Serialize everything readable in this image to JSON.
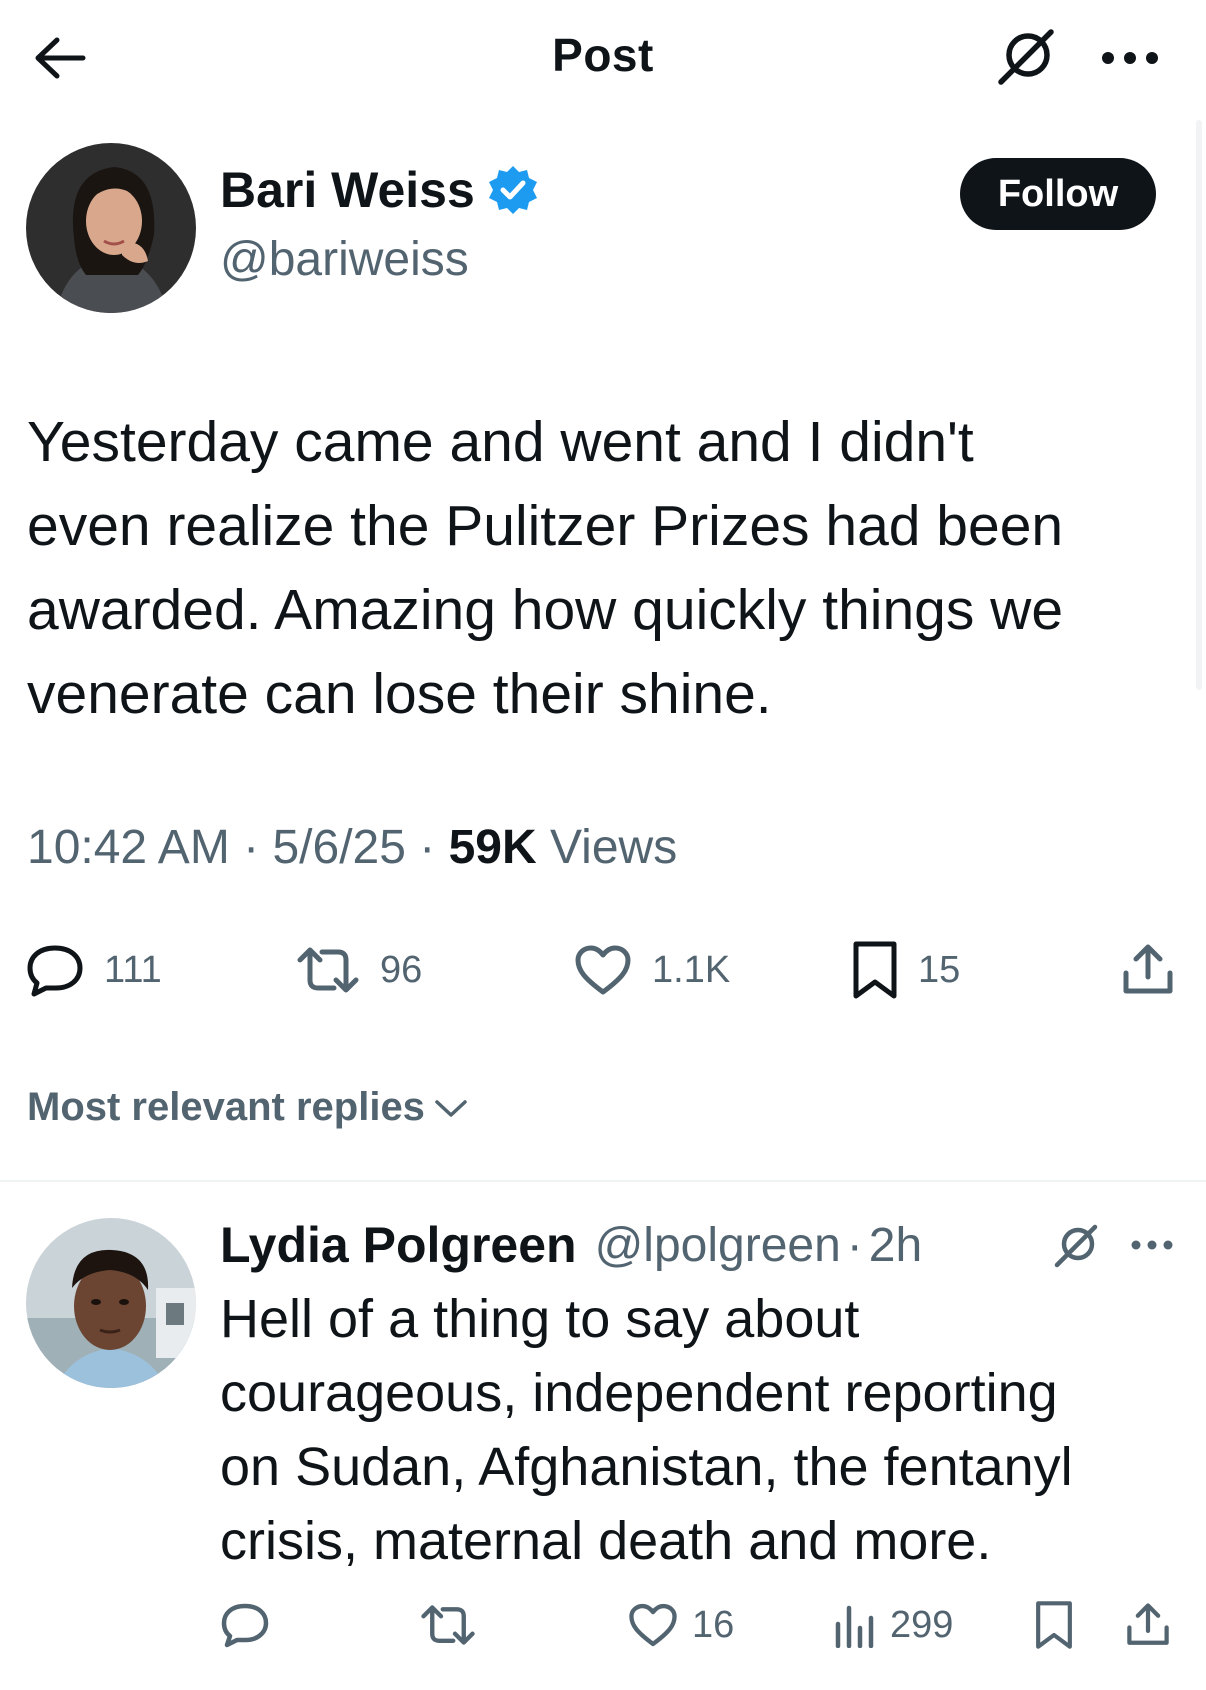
{
  "header": {
    "title": "Post",
    "back_icon": "arrow-left-icon",
    "grok_icon": "grok-icon",
    "more_icon": "more-horizontal-icon"
  },
  "post": {
    "author": {
      "name": "Bari Weiss",
      "handle": "@bariweiss",
      "verified": true,
      "verified_color": "#1d9bf0"
    },
    "follow_label": "Follow",
    "text_lines": [
      "Yesterday came and went and I didn't",
      "even realize the Pulitzer Prizes had been",
      "awarded. Amazing how quickly things we",
      "venerate can lose their shine."
    ],
    "time": "10:42 AM",
    "date": "5/6/25",
    "separator": "·",
    "views_count": "59K",
    "views_label": "Views",
    "stats": {
      "replies": "111",
      "reposts": "96",
      "likes": "1.1K",
      "bookmarks": "15"
    }
  },
  "replies_section": {
    "sort_label": "Most relevant replies"
  },
  "reply": {
    "name": "Lydia Polgreen",
    "handle": "@lpolgreen",
    "separator": "·",
    "time": "2h",
    "text_lines": [
      "Hell of a thing to say about",
      "courageous, independent reporting",
      "on Sudan, Afghanistan, the fentanyl",
      "crisis, maternal death and more."
    ],
    "stats": {
      "likes": "16",
      "views": "299"
    }
  },
  "colors": {
    "text_primary": "#0f1419",
    "text_secondary": "#536471",
    "accent_blue": "#1d9bf0",
    "divider": "#eff3f4",
    "button_dark": "#0f1419"
  }
}
